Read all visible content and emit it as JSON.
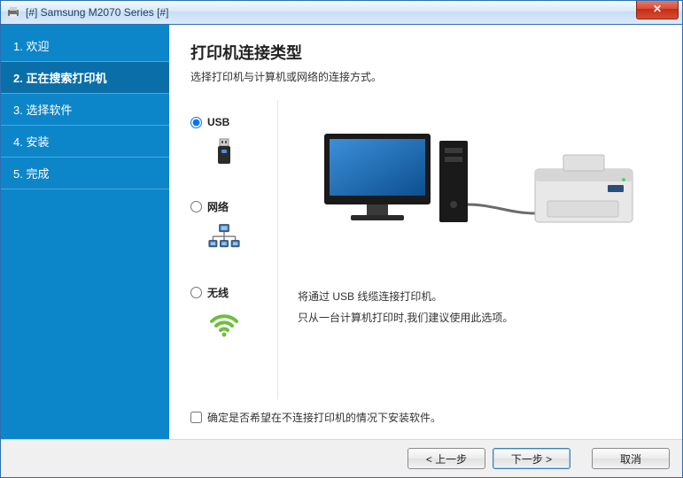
{
  "window": {
    "title": "[#] Samsung M2070 Series [#]",
    "close_glyph": "✕"
  },
  "sidebar": {
    "steps": [
      {
        "label": "1. 欢迎"
      },
      {
        "label": "2. 正在搜索打印机"
      },
      {
        "label": "3. 选择软件"
      },
      {
        "label": "4. 安装"
      },
      {
        "label": "5. 完成"
      }
    ],
    "active_index": 1
  },
  "main": {
    "heading": "打印机连接类型",
    "subtitle": "选择打印机与计算机或网络的连接方式。"
  },
  "options": {
    "selected": "usb",
    "usb_label": "USB",
    "network_label": "网络",
    "wireless_label": "无线"
  },
  "description": {
    "line1": "将通过 USB 线缆连接打印机。",
    "line2": "只从一台计算机打印时,我们建议使用此选项。"
  },
  "checkbox": {
    "checked": false,
    "label": "确定是否希望在不连接打印机的情况下安装软件。"
  },
  "footer": {
    "back": "< 上一步",
    "next": "下一步 >",
    "cancel": "取消"
  }
}
